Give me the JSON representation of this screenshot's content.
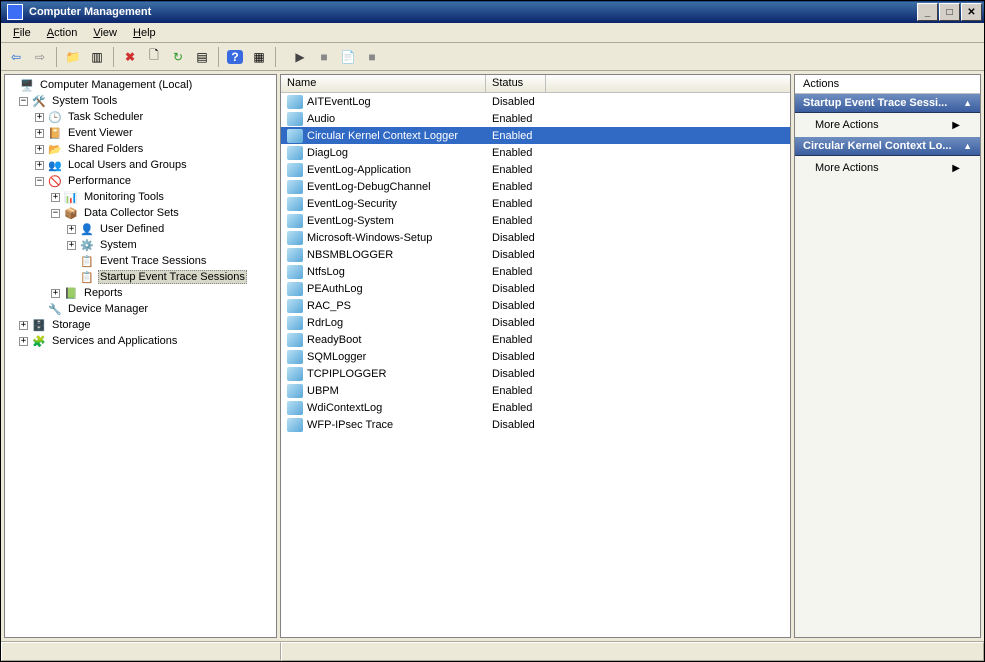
{
  "title": "Computer Management",
  "menus": [
    "File",
    "Action",
    "View",
    "Help"
  ],
  "toolbar": {
    "back": "⇦",
    "fwd": "⇨",
    "up": "📁",
    "props": "▥",
    "delete": "✖",
    "refresh": "🗋",
    "reload": "↻",
    "export": "▤",
    "help": "?",
    "showhide": "▦",
    "play": "▶",
    "stop": "■",
    "new": "📄",
    "save": "■"
  },
  "tree": {
    "root": "Computer Management (Local)",
    "systools": "System Tools",
    "tasksched": "Task Scheduler",
    "eventvwr": "Event Viewer",
    "sharedfolders": "Shared Folders",
    "localusers": "Local Users and Groups",
    "performance": "Performance",
    "montools": "Monitoring Tools",
    "dcs": "Data Collector Sets",
    "userdef": "User Defined",
    "system": "System",
    "ets": "Event Trace Sessions",
    "sets": "Startup Event Trace Sessions",
    "reports": "Reports",
    "devmgr": "Device Manager",
    "storage": "Storage",
    "svcapps": "Services and Applications"
  },
  "list": {
    "columns": {
      "name": "Name",
      "status": "Status"
    },
    "rows": [
      {
        "name": "AITEventLog",
        "status": "Disabled"
      },
      {
        "name": "Audio",
        "status": "Enabled"
      },
      {
        "name": "Circular Kernel Context Logger",
        "status": "Enabled",
        "selected": true
      },
      {
        "name": "DiagLog",
        "status": "Enabled"
      },
      {
        "name": "EventLog-Application",
        "status": "Enabled"
      },
      {
        "name": "EventLog-DebugChannel",
        "status": "Enabled"
      },
      {
        "name": "EventLog-Security",
        "status": "Enabled"
      },
      {
        "name": "EventLog-System",
        "status": "Enabled"
      },
      {
        "name": "Microsoft-Windows-Setup",
        "status": "Disabled"
      },
      {
        "name": "NBSMBLOGGER",
        "status": "Disabled"
      },
      {
        "name": "NtfsLog",
        "status": "Enabled"
      },
      {
        "name": "PEAuthLog",
        "status": "Disabled"
      },
      {
        "name": "RAC_PS",
        "status": "Disabled"
      },
      {
        "name": "RdrLog",
        "status": "Disabled"
      },
      {
        "name": "ReadyBoot",
        "status": "Enabled"
      },
      {
        "name": "SQMLogger",
        "status": "Disabled"
      },
      {
        "name": "TCPIPLOGGER",
        "status": "Disabled"
      },
      {
        "name": "UBPM",
        "status": "Enabled"
      },
      {
        "name": "WdiContextLog",
        "status": "Enabled"
      },
      {
        "name": "WFP-IPsec Trace",
        "status": "Disabled"
      }
    ]
  },
  "actions": {
    "header": "Actions",
    "group1": "Startup Event Trace Sessi...",
    "group2": "Circular Kernel Context Lo...",
    "more": "More Actions"
  }
}
